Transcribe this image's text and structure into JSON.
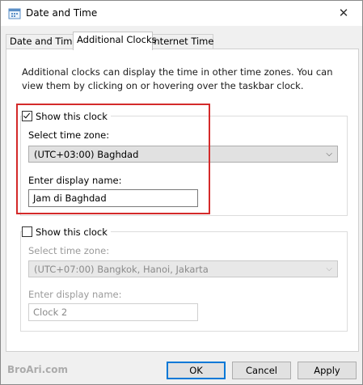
{
  "window": {
    "title": "Date and Time",
    "close_glyph": "✕"
  },
  "tabs": [
    {
      "label": "Date and Time"
    },
    {
      "label": "Additional Clocks",
      "active": true
    },
    {
      "label": "Internet Time"
    }
  ],
  "intro_text": "Additional clocks can display the time in other time zones. You can view them by clicking on or hovering over the taskbar clock.",
  "clock1": {
    "show_label": "Show this clock",
    "checked": true,
    "timezone_label": "Select time zone:",
    "timezone_value": "(UTC+03:00) Baghdad",
    "name_label": "Enter display name:",
    "name_value": "Jam di Baghdad"
  },
  "clock2": {
    "show_label": "Show this clock",
    "checked": false,
    "timezone_label": "Select time zone:",
    "timezone_value": "(UTC+07:00) Bangkok, Hanoi, Jakarta",
    "name_label": "Enter display name:",
    "name_value": "Clock 2"
  },
  "watermark": "BroAri.com",
  "buttons": {
    "ok": "OK",
    "cancel": "Cancel",
    "apply": "Apply"
  },
  "icons": {
    "chevron": "⌵",
    "app_icon": "clock-calendar-icon"
  },
  "colors": {
    "highlight": "#d42a2a",
    "accent": "#0078d7"
  }
}
